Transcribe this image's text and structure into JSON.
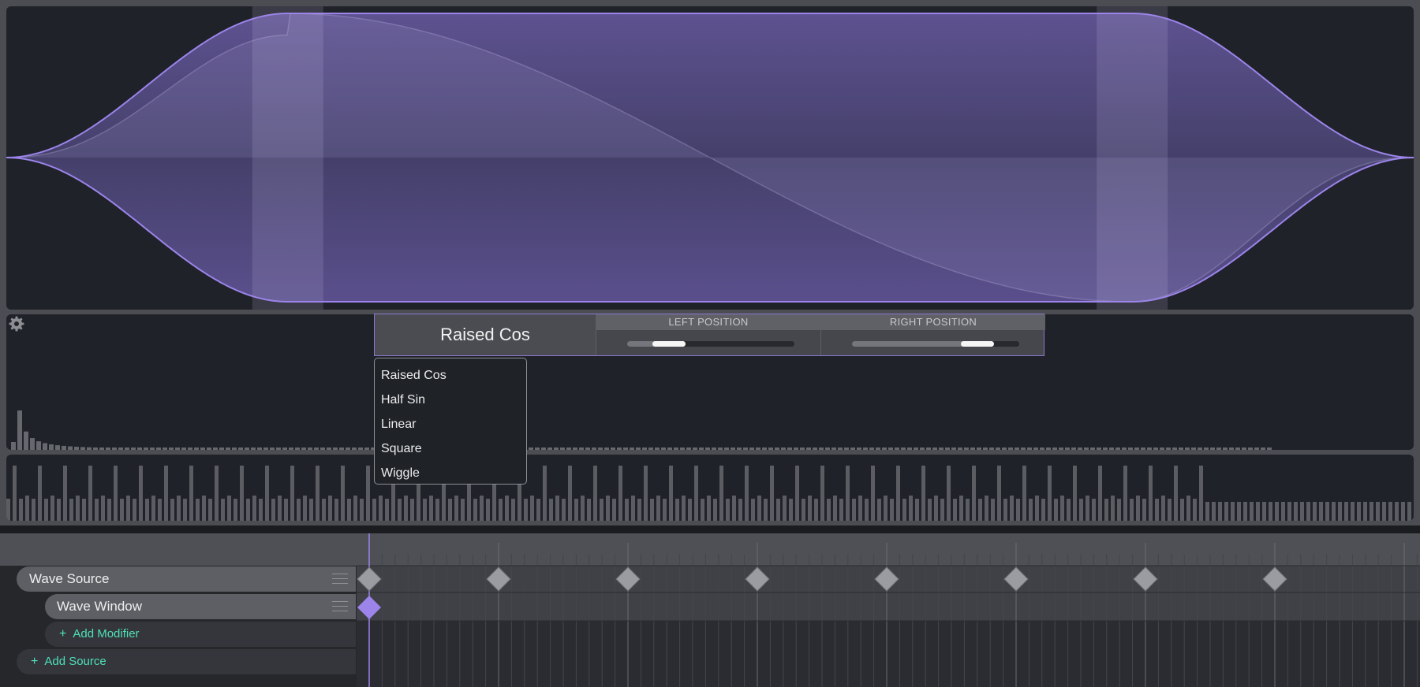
{
  "accent_color": "#9c84ea",
  "window_editor": {
    "selected_type": "Raised Cos",
    "left_position": {
      "label": "LEFT POSITION",
      "value": 0.25
    },
    "right_position": {
      "label": "RIGHT POSITION",
      "value": 0.75
    }
  },
  "window_type_menu": {
    "options": [
      "Raised Cos",
      "Half Sin",
      "Linear",
      "Square",
      "Wiggle"
    ]
  },
  "settings": {
    "icon": "gear-icon"
  },
  "timeline": {
    "rows": [
      {
        "label": "Wave Source",
        "icon": "drag-handle-icon"
      },
      {
        "label": "Wave Window",
        "icon": "drag-handle-icon"
      }
    ],
    "add_modifier_label": "Add Modifier",
    "add_source_label": "Add Source",
    "add_icon": "plus-icon"
  }
}
